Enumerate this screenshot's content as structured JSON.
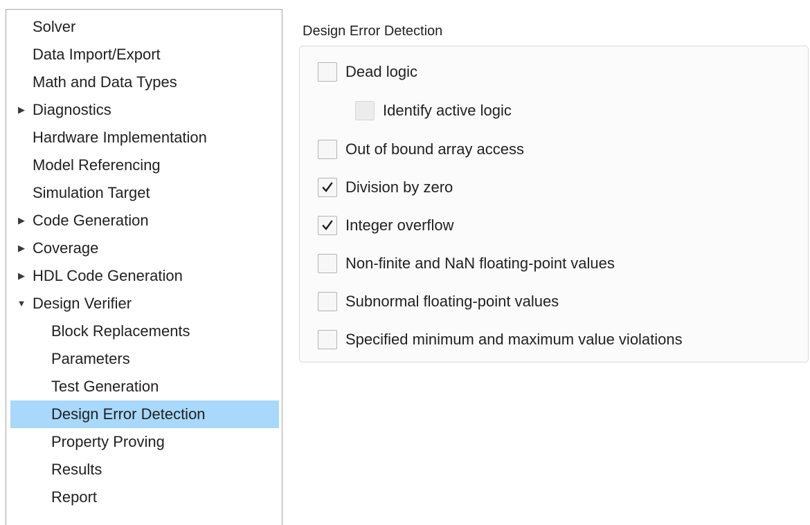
{
  "nav": {
    "items": [
      {
        "label": "Solver",
        "level": 0,
        "expander": "none"
      },
      {
        "label": "Data Import/Export",
        "level": 0,
        "expander": "none"
      },
      {
        "label": "Math and Data Types",
        "level": 0,
        "expander": "none"
      },
      {
        "label": "Diagnostics",
        "level": 0,
        "expander": "collapsed"
      },
      {
        "label": "Hardware Implementation",
        "level": 0,
        "expander": "none"
      },
      {
        "label": "Model Referencing",
        "level": 0,
        "expander": "none"
      },
      {
        "label": "Simulation Target",
        "level": 0,
        "expander": "none"
      },
      {
        "label": "Code Generation",
        "level": 0,
        "expander": "collapsed"
      },
      {
        "label": "Coverage",
        "level": 0,
        "expander": "collapsed"
      },
      {
        "label": "HDL Code Generation",
        "level": 0,
        "expander": "collapsed"
      },
      {
        "label": "Design Verifier",
        "level": 0,
        "expander": "expanded"
      },
      {
        "label": "Block Replacements",
        "level": 1,
        "expander": "none"
      },
      {
        "label": "Parameters",
        "level": 1,
        "expander": "none"
      },
      {
        "label": "Test Generation",
        "level": 1,
        "expander": "none"
      },
      {
        "label": "Design Error Detection",
        "level": 1,
        "expander": "none",
        "selected": true
      },
      {
        "label": "Property Proving",
        "level": 1,
        "expander": "none"
      },
      {
        "label": "Results",
        "level": 1,
        "expander": "none"
      },
      {
        "label": "Report",
        "level": 1,
        "expander": "none"
      }
    ],
    "expander_icons": {
      "collapsed": "triangle-right-icon",
      "expanded": "triangle-down-icon"
    },
    "selected_color": "#a8d8fb"
  },
  "panel": {
    "title": "Design Error Detection",
    "options": [
      {
        "label": "Dead logic",
        "checked": false,
        "enabled": true,
        "indent": 0
      },
      {
        "label": "Identify active logic",
        "checked": false,
        "enabled": false,
        "indent": 1
      },
      {
        "label": "Out of bound array access",
        "checked": false,
        "enabled": true,
        "indent": 0
      },
      {
        "label": "Division by zero",
        "checked": true,
        "enabled": true,
        "indent": 0
      },
      {
        "label": "Integer overflow",
        "checked": true,
        "enabled": true,
        "indent": 0
      },
      {
        "label": "Non-finite and NaN floating-point values",
        "checked": false,
        "enabled": true,
        "indent": 0
      },
      {
        "label": "Subnormal floating-point values",
        "checked": false,
        "enabled": true,
        "indent": 0
      },
      {
        "label": "Specified minimum and maximum value violations",
        "checked": false,
        "enabled": true,
        "indent": 0
      }
    ]
  }
}
